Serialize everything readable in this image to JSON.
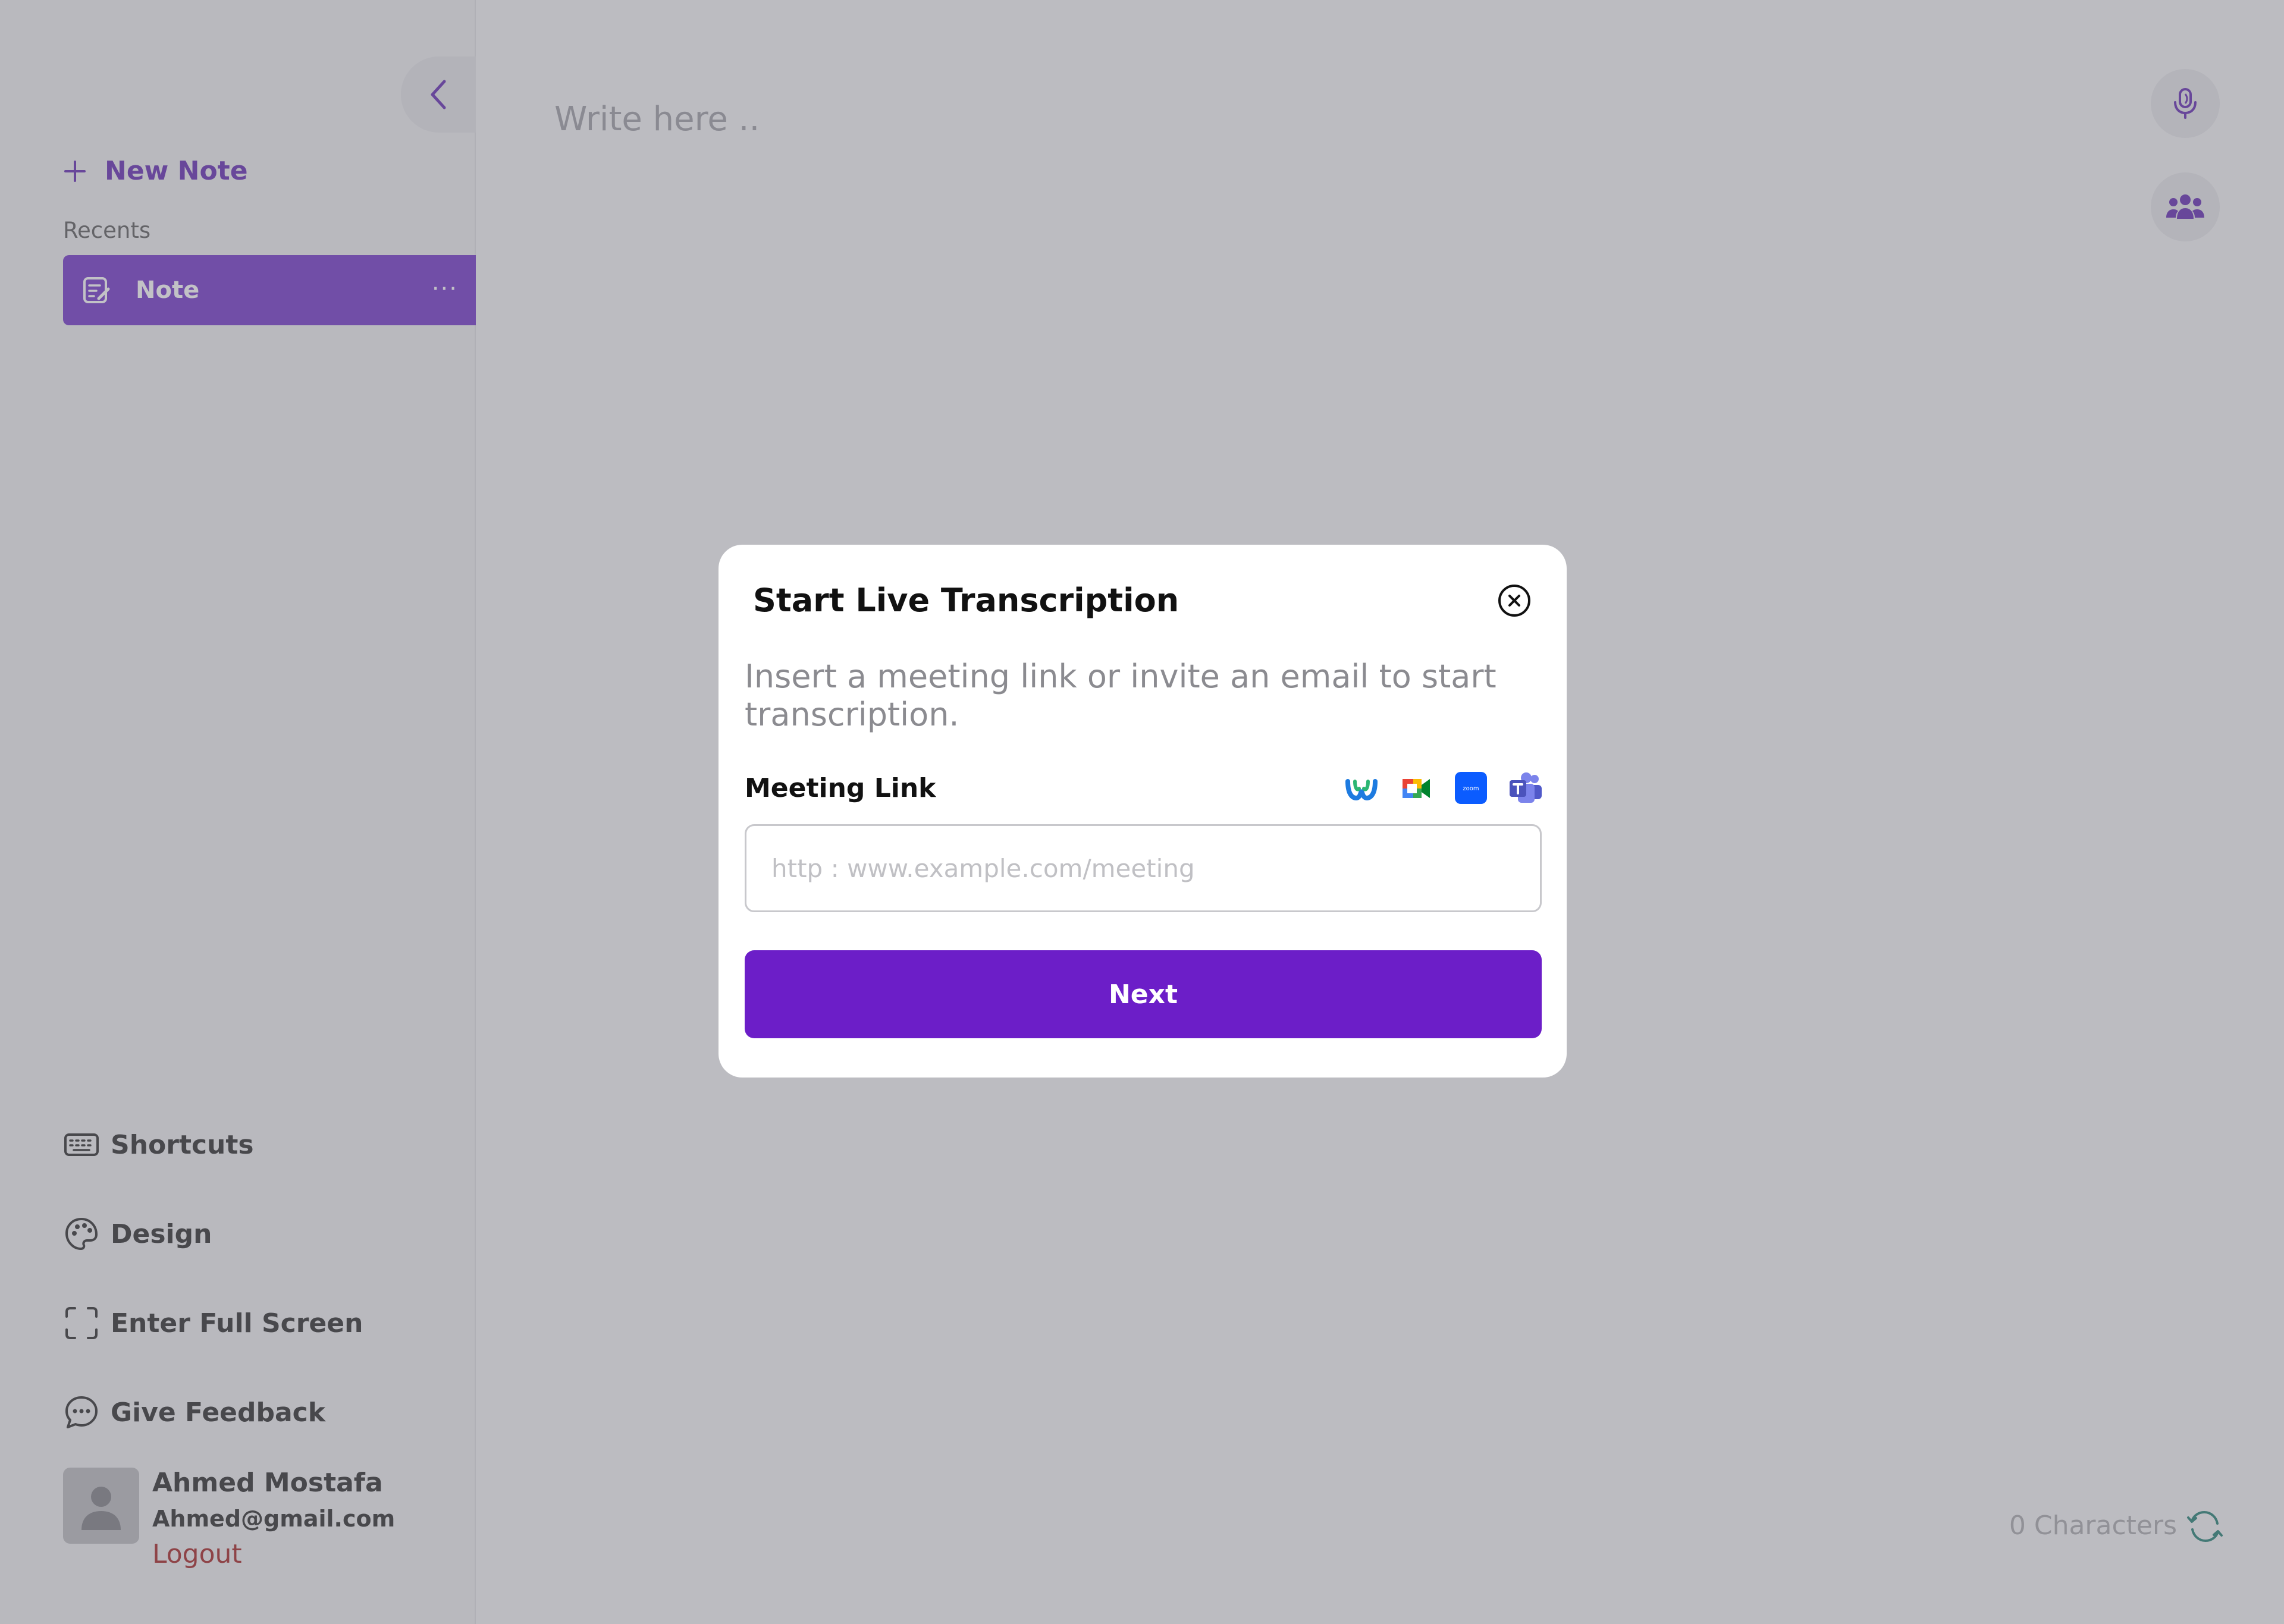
{
  "sidebar": {
    "new_note_label": "New Note",
    "recents_label": "Recents",
    "note_item_label": "Note",
    "more_label": "···",
    "links": {
      "shortcuts": "Shortcuts",
      "design": "Design",
      "fullscreen": "Enter Full Screen",
      "feedback": "Give Feedback"
    },
    "user": {
      "name": "Ahmed Mostafa",
      "email": "Ahmed@gmail.com",
      "logout_label": "Logout"
    }
  },
  "editor": {
    "placeholder": "Write here ..",
    "char_count": "0 Characters"
  },
  "modal": {
    "title": "Start Live Transcription",
    "description": "Insert a meeting link or invite an email to start transcription.",
    "field_label": "Meeting Link",
    "input_placeholder": "http : www.example.com/meeting",
    "input_value": "",
    "next_label": "Next",
    "services": [
      "webex-icon",
      "google-meet-icon",
      "zoom-icon",
      "teams-icon"
    ]
  },
  "icons": {
    "collapse": "chevron-left-icon",
    "new_note": "plus-icon",
    "note": "note-edit-icon",
    "shortcuts": "keyboard-icon",
    "design": "palette-icon",
    "fullscreen": "fullscreen-icon",
    "feedback": "chat-bubble-icon",
    "avatar": "user-icon",
    "mic": "microphone-icon",
    "group": "group-icon",
    "refresh": "refresh-icon",
    "close": "close-circle-icon"
  },
  "colors": {
    "accent": "#6c1ec8",
    "note_item_bg": "#6c2cc7",
    "logout": "#a01818"
  }
}
